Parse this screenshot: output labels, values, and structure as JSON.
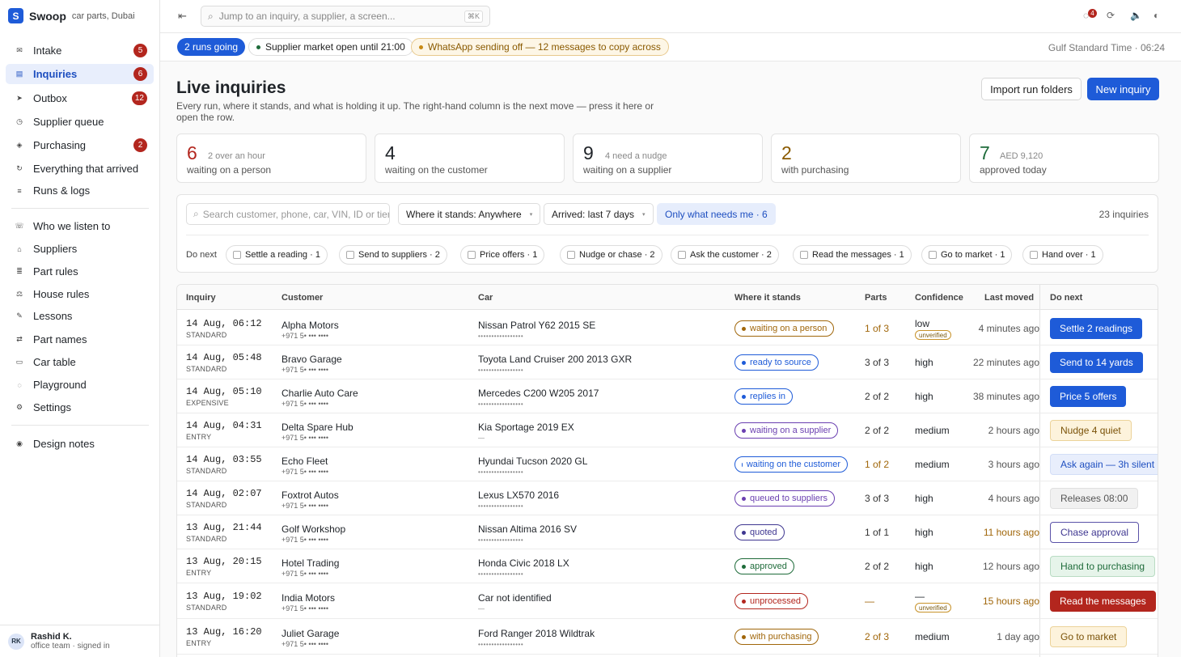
{
  "brand": {
    "letter": "S",
    "name": "Swoop",
    "subtitle": "car parts, Dubai"
  },
  "nav": [
    {
      "icon": "✉",
      "label": "Intake",
      "badge": "5"
    },
    {
      "icon": "▤",
      "label": "Inquiries",
      "badge": "6",
      "active": true
    },
    {
      "icon": "➤",
      "label": "Outbox",
      "badge": "12"
    },
    {
      "icon": "◷",
      "label": "Supplier queue",
      "badge": ""
    },
    {
      "icon": "◈",
      "label": "Purchasing",
      "badge": "2"
    },
    {
      "icon": "↻",
      "label": "Everything that arrived",
      "badge": ""
    },
    {
      "icon": "≡",
      "label": "Runs & logs",
      "badge": ""
    },
    {
      "icon": "☏",
      "label": "Who we listen to",
      "badge": ""
    },
    {
      "icon": "⌂",
      "label": "Suppliers",
      "badge": ""
    },
    {
      "icon": "≣",
      "label": "Part rules",
      "badge": ""
    },
    {
      "icon": "⚖",
      "label": "House rules",
      "badge": ""
    },
    {
      "icon": "✎",
      "label": "Lessons",
      "badge": ""
    },
    {
      "icon": "⇄",
      "label": "Part names",
      "badge": ""
    },
    {
      "icon": "▭",
      "label": "Car table",
      "badge": ""
    },
    {
      "icon": "◌",
      "label": "Playground",
      "badge": ""
    },
    {
      "icon": "⚙",
      "label": "Settings",
      "badge": ""
    },
    {
      "icon": "◉",
      "label": "Design notes",
      "badge": ""
    }
  ],
  "user": {
    "initials": "RK",
    "name": "Rashid K.",
    "role": "office team · signed in"
  },
  "topbar": {
    "collapse_icon": "⇤",
    "search_placeholder": "Jump to an inquiry, a supplier, a screen...",
    "shortcut": "⌘K",
    "notif_count": "4"
  },
  "statusbar": {
    "runs": "2 runs going",
    "market": "Supplier market open until 21:00",
    "whatsapp": "WhatsApp sending off — 12 messages to copy across",
    "clock": "Gulf Standard Time · 06:24"
  },
  "header": {
    "title": "Live inquiries",
    "subtitle": "Every run, where it stands, and what is holding it up. The right-hand column is the next move — press it here or open the row.",
    "import_label": "Import run folders",
    "new_label": "New inquiry"
  },
  "stats": [
    {
      "value": "6",
      "note": "2 over an hour",
      "label": "waiting on a person",
      "color": "#b3261e"
    },
    {
      "value": "4",
      "note": "",
      "label": "waiting on the customer",
      "color": "#1f2328"
    },
    {
      "value": "9",
      "note": "4 need a nudge",
      "label": "waiting on a supplier",
      "color": "#1f2328"
    },
    {
      "value": "2",
      "note": "",
      "label": "with purchasing",
      "color": "#8a5a00"
    },
    {
      "value": "7",
      "note": "AED 9,120",
      "label": "approved today",
      "color": "#1e6b3a"
    }
  ],
  "filters": {
    "search_placeholder": "Search customer, phone, car, VIN, ID or tier",
    "where": "Where it stands: Anywhere",
    "arrived": "Arrived: last 7 days",
    "mine": "Only what needs me · 6",
    "count": "23 inquiries",
    "do_next_label": "Do next",
    "chips": [
      "Settle a reading · 1",
      "Send to suppliers · 2",
      "Price offers · 1",
      "Nudge or chase · 2",
      "Ask the customer · 2",
      "Read the messages · 1",
      "Go to market · 1",
      "Hand over · 1"
    ]
  },
  "table": {
    "columns": [
      "Inquiry",
      "Customer",
      "Car",
      "Where it stands",
      "Parts",
      "Confidence",
      "Last moved",
      "Do next"
    ],
    "rows": [
      {
        "date": "14 Aug, 06:12",
        "tier": "STANDARD",
        "customer": "Alpha Motors",
        "phone": "+971 5• ••• ••••",
        "car": "Nissan Patrol Y62 2015 SE",
        "vin": "•••••••••••••••••",
        "status": "waiting on a person",
        "status_color": "#a0660a",
        "parts": "1 of 3",
        "parts_color": "#a0660a",
        "confidence": "low",
        "unverified": "unverified",
        "moved": "4 minutes ago",
        "moved_color": "#555",
        "action": "Settle 2 readings",
        "action_style": "a-primary"
      },
      {
        "date": "14 Aug, 05:48",
        "tier": "STANDARD",
        "customer": "Bravo Garage",
        "phone": "+971 5• ••• ••••",
        "car": "Toyota Land Cruiser 200 2013 GXR",
        "vin": "•••••••••••••••••",
        "status": "ready to source",
        "status_color": "#1e5bd8",
        "parts": "3 of 3",
        "parts_color": "#333",
        "confidence": "high",
        "unverified": "",
        "moved": "22 minutes ago",
        "moved_color": "#555",
        "action": "Send to 14 yards",
        "action_style": "a-primary"
      },
      {
        "date": "14 Aug, 05:10",
        "tier": "EXPENSIVE",
        "customer": "Charlie Auto Care",
        "phone": "+971 5• ••• ••••",
        "car": "Mercedes C200 W205 2017",
        "vin": "•••••••••••••••••",
        "status": "replies in",
        "status_color": "#1e5bd8",
        "parts": "2 of 2",
        "parts_color": "#333",
        "confidence": "high",
        "unverified": "",
        "moved": "38 minutes ago",
        "moved_color": "#555",
        "action": "Price 5 offers",
        "action_style": "a-primary"
      },
      {
        "date": "14 Aug, 04:31",
        "tier": "ENTRY",
        "customer": "Delta Spare Hub",
        "phone": "+971 5• ••• ••••",
        "car": "Kia Sportage 2019 EX",
        "vin": "—",
        "status": "waiting on a supplier",
        "status_color": "#6a3fb0",
        "parts": "2 of 2",
        "parts_color": "#333",
        "confidence": "medium",
        "unverified": "",
        "moved": "2 hours ago",
        "moved_color": "#555",
        "action": "Nudge 4 quiet",
        "action_style": "a-amber"
      },
      {
        "date": "14 Aug, 03:55",
        "tier": "STANDARD",
        "customer": "Echo Fleet",
        "phone": "+971 5• ••• ••••",
        "car": "Hyundai Tucson 2020 GL",
        "vin": "•••••••••••••••••",
        "status": "waiting on the customer",
        "status_color": "#1e5bd8",
        "parts": "1 of 2",
        "parts_color": "#a0660a",
        "confidence": "medium",
        "unverified": "",
        "moved": "3 hours ago",
        "moved_color": "#555",
        "action": "Ask again — 3h silent",
        "action_style": "a-blue"
      },
      {
        "date": "14 Aug, 02:07",
        "tier": "STANDARD",
        "customer": "Foxtrot Autos",
        "phone": "+971 5• ••• ••••",
        "car": "Lexus LX570 2016",
        "vin": "•••••••••••••••••",
        "status": "queued to suppliers",
        "status_color": "#6a3fb0",
        "parts": "3 of 3",
        "parts_color": "#333",
        "confidence": "high",
        "unverified": "",
        "moved": "4 hours ago",
        "moved_color": "#555",
        "action": "Releases 08:00",
        "action_style": "a-gray"
      },
      {
        "date": "13 Aug, 21:44",
        "tier": "STANDARD",
        "customer": "Golf Workshop",
        "phone": "+971 5• ••• ••••",
        "car": "Nissan Altima 2016 SV",
        "vin": "•••••••••••••••••",
        "status": "quoted",
        "status_color": "#3e3690",
        "parts": "1 of 1",
        "parts_color": "#333",
        "confidence": "high",
        "unverified": "",
        "moved": "11 hours ago",
        "moved_color": "#a0660a",
        "action": "Chase approval",
        "action_style": "a-outline"
      },
      {
        "date": "13 Aug, 20:15",
        "tier": "ENTRY",
        "customer": "Hotel Trading",
        "phone": "+971 5• ••• ••••",
        "car": "Honda Civic 2018 LX",
        "vin": "•••••••••••••••••",
        "status": "approved",
        "status_color": "#1e6b3a",
        "parts": "2 of 2",
        "parts_color": "#333",
        "confidence": "high",
        "unverified": "",
        "moved": "12 hours ago",
        "moved_color": "#555",
        "action": "Hand to purchasing",
        "action_style": "a-green"
      },
      {
        "date": "13 Aug, 19:02",
        "tier": "STANDARD",
        "customer": "India Motors",
        "phone": "+971 5• ••• ••••",
        "car": "Car not identified",
        "vin": "—",
        "status": "unprocessed",
        "status_color": "#b3261e",
        "parts": "—",
        "parts_color": "#a0660a",
        "confidence": "—",
        "unverified": "unverified",
        "moved": "15 hours ago",
        "moved_color": "#a0660a",
        "action": "Read the messages",
        "action_style": "a-red"
      },
      {
        "date": "13 Aug, 16:20",
        "tier": "ENTRY",
        "customer": "Juliet Garage",
        "phone": "+971 5• ••• ••••",
        "car": "Ford Ranger 2018 Wildtrak",
        "vin": "•••••••••••••••••",
        "status": "with purchasing",
        "status_color": "#a0660a",
        "parts": "2 of 3",
        "parts_color": "#a0660a",
        "confidence": "medium",
        "unverified": "",
        "moved": "1 day ago",
        "moved_color": "#555",
        "action": "Go to market",
        "action_style": "a-amber"
      }
    ]
  }
}
